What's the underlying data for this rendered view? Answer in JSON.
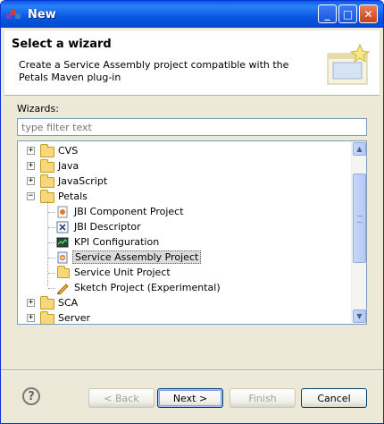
{
  "window": {
    "title": "New"
  },
  "title_buttons": {
    "minimize": "_",
    "maximize": "□",
    "close": "✕"
  },
  "banner": {
    "heading": "Select a wizard",
    "description": "Create a Service Assembly project compatible with the Petals Maven plug-in"
  },
  "wizards_label": "Wizards:",
  "filter": {
    "placeholder": "type filter text",
    "value": ""
  },
  "tree": {
    "items": [
      {
        "label": "CVS",
        "type": "folder",
        "expanded": false,
        "level": 0,
        "icon": "folder-icon"
      },
      {
        "label": "Java",
        "type": "folder",
        "expanded": false,
        "level": 0,
        "icon": "folder-icon"
      },
      {
        "label": "JavaScript",
        "type": "folder",
        "expanded": false,
        "level": 0,
        "icon": "folder-icon"
      },
      {
        "label": "Petals",
        "type": "folder",
        "expanded": true,
        "level": 0,
        "icon": "folder-open-icon"
      },
      {
        "label": "JBI Component Project",
        "type": "leaf",
        "level": 1,
        "icon": "jbi-component-icon"
      },
      {
        "label": "JBI Descriptor",
        "type": "leaf",
        "level": 1,
        "icon": "jbi-descriptor-icon"
      },
      {
        "label": "KPI Configuration",
        "type": "leaf",
        "level": 1,
        "icon": "kpi-icon"
      },
      {
        "label": "Service Assembly Project",
        "type": "leaf",
        "level": 1,
        "icon": "service-assembly-icon",
        "selected": true
      },
      {
        "label": "Service Unit Project",
        "type": "leaf",
        "level": 1,
        "icon": "service-unit-icon"
      },
      {
        "label": "Sketch Project (Experimental)",
        "type": "leaf",
        "level": 1,
        "icon": "sketch-icon"
      },
      {
        "label": "SCA",
        "type": "folder",
        "expanded": false,
        "level": 0,
        "icon": "folder-icon"
      },
      {
        "label": "Server",
        "type": "folder",
        "expanded": false,
        "level": 0,
        "icon": "folder-icon"
      }
    ]
  },
  "buttons": {
    "help": "?",
    "back": "< Back",
    "next": "Next >",
    "finish": "Finish",
    "cancel": "Cancel"
  },
  "colors": {
    "titlebar": "#0a58e4",
    "selection": "#dcdcdc",
    "dialog_bg": "#ece9d8"
  }
}
